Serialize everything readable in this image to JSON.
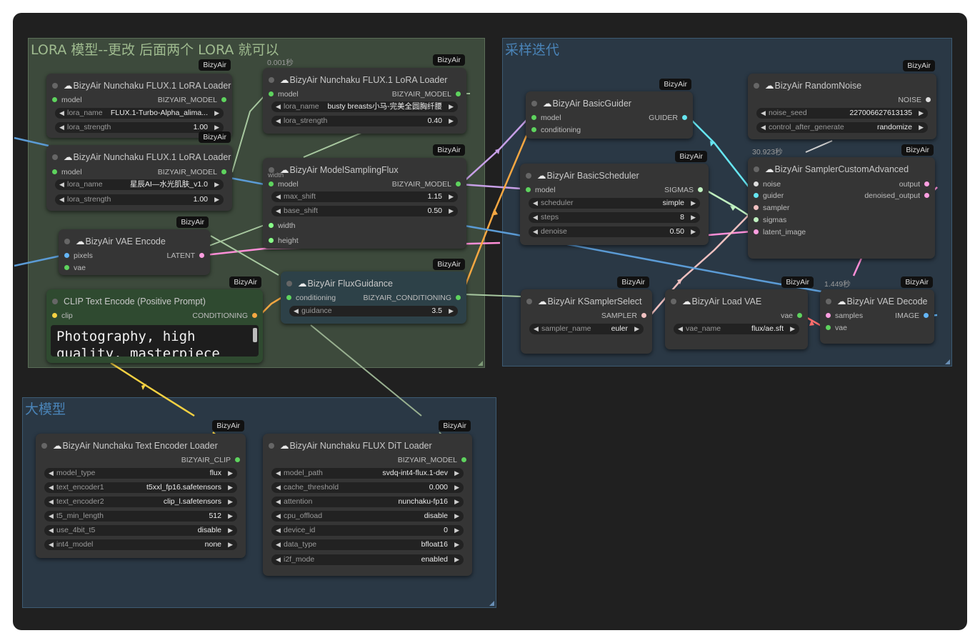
{
  "groups": {
    "lora": {
      "title": "LORA 模型--更改 后面两个 LORA 就可以"
    },
    "sampling": {
      "title": "采样迭代"
    },
    "base": {
      "title": "大模型"
    }
  },
  "badge": "BizyAir",
  "times": {
    "lora2": "0.001秒",
    "sampler_adv": "30.923秒",
    "vae_decode": "1.449秒"
  },
  "colors": {
    "model": "#5ed35e",
    "clip": "#f5d142",
    "conditioning": "#f5a742",
    "latent": "#ff9ee0",
    "vae": "#ff6e6e",
    "guider": "#66e5f0",
    "sampler": "#f0c0c0",
    "sigmas": "#c0f0c0",
    "noise": "#dddddd",
    "image": "#64b5f6",
    "pixels": "#64b5f6",
    "int": "#88ff88"
  },
  "nodes": {
    "lora1": {
      "title": "BizyAir Nunchaku FLUX.1 LoRA Loader",
      "in_model": "model",
      "out_model": "BIZYAIR_MODEL",
      "widgets": [
        {
          "label": "lora_name",
          "value": "FLUX.1-Turbo-Alpha_alima..."
        },
        {
          "label": "lora_strength",
          "value": "1.00"
        }
      ]
    },
    "lora2": {
      "title": "BizyAir Nunchaku FLUX.1 LoRA Loader",
      "in_model": "model",
      "out_model": "BIZYAIR_MODEL",
      "widgets": [
        {
          "label": "lora_name",
          "value": "busty breasts小马-完美全圆胸纤腰"
        },
        {
          "label": "lora_strength",
          "value": "0.40"
        }
      ]
    },
    "lora3": {
      "title": "BizyAir Nunchaku FLUX.1 LoRA Loader",
      "in_model": "model",
      "out_model": "BIZYAIR_MODEL",
      "widgets": [
        {
          "label": "lora_name",
          "value": "星辰AI—水光肌肤_v1.0"
        },
        {
          "label": "lora_strength",
          "value": "1.00"
        }
      ]
    },
    "msf": {
      "title": "BizyAir ModelSamplingFlux",
      "in_model": "model",
      "out_model": "BIZYAIR_MODEL",
      "in_width": "width",
      "in_height": "height",
      "ghost_width": "width",
      "widgets": [
        {
          "label": "max_shift",
          "value": "1.15"
        },
        {
          "label": "base_shift",
          "value": "0.50"
        }
      ]
    },
    "vae_enc": {
      "title": "BizyAir VAE Encode",
      "in_pixels": "pixels",
      "in_vae": "vae",
      "out_latent": "LATENT"
    },
    "clip": {
      "title": "CLIP Text Encode (Positive Prompt)",
      "in_clip": "clip",
      "out_cond": "CONDITIONING",
      "text": "Photography, high quality, masterpiece"
    },
    "fg": {
      "title": "BizyAir FluxGuidance",
      "in_cond": "conditioning",
      "out_cond": "BIZYAIR_CONDITIONING",
      "widgets": [
        {
          "label": "guidance",
          "value": "3.5"
        }
      ]
    },
    "guider": {
      "title": "BizyAir BasicGuider",
      "in_model": "model",
      "in_cond": "conditioning",
      "out": "GUIDER"
    },
    "sched": {
      "title": "BizyAir BasicScheduler",
      "in_model": "model",
      "out": "SIGMAS",
      "widgets": [
        {
          "label": "scheduler",
          "value": "simple"
        },
        {
          "label": "steps",
          "value": "8"
        },
        {
          "label": "denoise",
          "value": "0.50"
        }
      ]
    },
    "noise": {
      "title": "BizyAir RandomNoise",
      "out": "NOISE",
      "widgets": [
        {
          "label": "noise_seed",
          "value": "227006627613135"
        },
        {
          "label": "control_after_generate",
          "value": "randomize"
        }
      ]
    },
    "sca": {
      "title": "BizyAir SamplerCustomAdvanced",
      "in_noise": "noise",
      "in_guider": "guider",
      "in_sampler": "sampler",
      "in_sigmas": "sigmas",
      "in_latent": "latent_image",
      "out_output": "output",
      "out_denoised": "denoised_output"
    },
    "ksel": {
      "title": "BizyAir KSamplerSelect",
      "out": "SAMPLER",
      "widgets": [
        {
          "label": "sampler_name",
          "value": "euler"
        }
      ]
    },
    "lvae": {
      "title": "BizyAir Load VAE",
      "out": "vae",
      "widgets": [
        {
          "label": "vae_name",
          "value": "flux/ae.sft"
        }
      ]
    },
    "vdec": {
      "title": "BizyAir VAE Decode",
      "in_samples": "samples",
      "in_vae": "vae",
      "out": "IMAGE"
    },
    "tel": {
      "title": "BizyAir Nunchaku Text Encoder Loader",
      "out": "BIZYAIR_CLIP",
      "widgets": [
        {
          "label": "model_type",
          "value": "flux"
        },
        {
          "label": "text_encoder1",
          "value": "t5xxl_fp16.safetensors"
        },
        {
          "label": "text_encoder2",
          "value": "clip_l.safetensors"
        },
        {
          "label": "t5_min_length",
          "value": "512"
        },
        {
          "label": "use_4bit_t5",
          "value": "disable"
        },
        {
          "label": "int4_model",
          "value": "none"
        }
      ]
    },
    "dit": {
      "title": "BizyAir Nunchaku FLUX DiT Loader",
      "out": "BIZYAIR_MODEL",
      "widgets": [
        {
          "label": "model_path",
          "value": "svdq-int4-flux.1-dev"
        },
        {
          "label": "cache_threshold",
          "value": "0.000"
        },
        {
          "label": "attention",
          "value": "nunchaku-fp16"
        },
        {
          "label": "cpu_offload",
          "value": "disable"
        },
        {
          "label": "device_id",
          "value": "0"
        },
        {
          "label": "data_type",
          "value": "bfloat16"
        },
        {
          "label": "i2f_mode",
          "value": "enabled"
        }
      ]
    }
  }
}
